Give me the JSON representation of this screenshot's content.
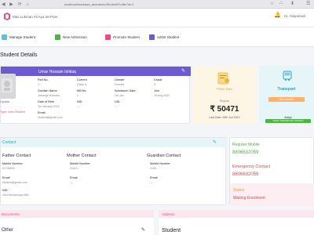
{
  "browser": {
    "url": "localhost/madrasa_aboramec/StudentProfile?id=1"
  },
  "app": {
    "brand": "Mas Lukman Ali Aya Iet Poer",
    "profile": "Hi, Alayamazi"
  },
  "menu": [
    {
      "label": "Manage Student",
      "color": "#5bc0de"
    },
    {
      "label": "New Admission",
      "color": "#4bb543"
    },
    {
      "label": "Promote Student",
      "color": "#e94f7b"
    },
    {
      "label": "Admit Student",
      "color": "#6b5ad1"
    }
  ],
  "page_title": "Student Details",
  "profile_card": {
    "name": "Umar Hossain Ishtiaq",
    "photo_label": "Update",
    "class_type": "Type: New Student",
    "fields": [
      {
        "label": "Roll No.",
        "value": "1"
      },
      {
        "label": "Gurdian Name",
        "value": "Jahangir Hossain"
      },
      {
        "label": "Date of Birth",
        "value": "1st January 2014"
      },
      {
        "label": "Email",
        "value": "student@gmail.com"
      },
      {
        "label": "Current",
        "value": "Class 4"
      },
      {
        "label": "Mill No",
        "value": "1"
      },
      {
        "label": "NID",
        "value": "—"
      },
      {
        "label": "Gender",
        "value": "Female"
      },
      {
        "label": "Admission Date",
        "value": "1st Jan"
      },
      {
        "label": "UID",
        "value": "—"
      },
      {
        "label": "Grade",
        "value": "5"
      },
      {
        "label": "Join",
        "value": "19 Aug 2022"
      }
    ]
  },
  "fees": {
    "title": "Fees Due",
    "subtitle": "Regular",
    "amount": "₹ 50471",
    "last_date": "Last Date: 25th Jun 2022"
  },
  "transport": {
    "title": "Transport",
    "badge": "Not enrolled",
    "button_top": "Assign",
    "button_bottom": "SAVE TRANSPORT ASSIGN"
  },
  "contact": {
    "title": "Contact",
    "father": {
      "title": "Father Contact",
      "mobile_label": "Mobile Number",
      "mobile": "01748942"
    },
    "mother": {
      "title": "Mother Contact",
      "mobile_label": "Mobile Number",
      "mobile": "01621...",
      "email_label": "Email",
      "email": "—"
    },
    "guardian": {
      "title": "Guardian Contact",
      "mobile_label": "Mobile Number",
      "mobile": "0160...",
      "email_label": "Email",
      "email": "—"
    },
    "email_label": "Email",
    "email": "student@gmail.com",
    "nid_label": "NID",
    "nid": "Juid Mohammad NID"
  },
  "side_contacts": {
    "register_mobile_label": "Register Mobile",
    "register_mobile": "8806632059",
    "emergency_label": "Emergency Contact",
    "emergency": "8806632059",
    "status_label": "Status",
    "status": "Waiting Enrolment"
  },
  "bottom": {
    "left_title": "Documents",
    "left_label": "Other",
    "address_title": "Address",
    "address_label": "Student"
  }
}
